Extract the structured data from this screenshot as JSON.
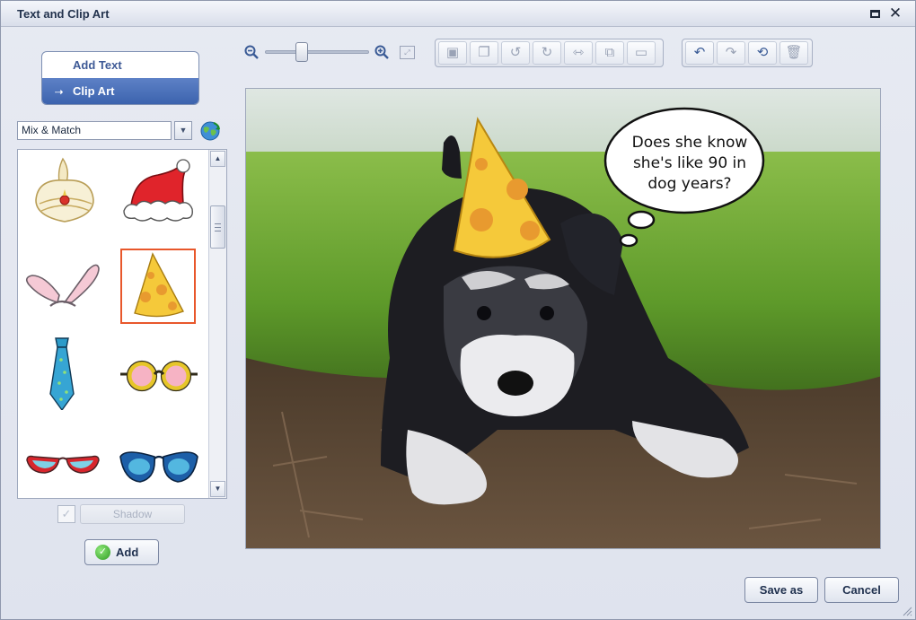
{
  "window": {
    "title": "Text and Clip Art"
  },
  "modes": [
    {
      "label": "Add Text",
      "active": false
    },
    {
      "label": "Clip Art",
      "active": true,
      "icon": "arrow-icon"
    }
  ],
  "clipart": {
    "category": "Mix & Match",
    "items": [
      "turban",
      "santa-hat",
      "bunny-ears",
      "party-hat",
      "necktie",
      "round-glasses",
      "sunglasses",
      "masquerade-glasses"
    ],
    "selected": "party-hat"
  },
  "options": {
    "shadow_label": "Shadow",
    "add_label": "Add"
  },
  "zoom": {
    "level": 0.33
  },
  "toolbar": {
    "edit_tools": [
      "crop-icon",
      "copy-icon",
      "rotate-left-icon",
      "rotate-right-icon",
      "flip-icon",
      "send-back-icon",
      "bring-front-icon"
    ],
    "history_tools": [
      "undo-icon",
      "redo-icon",
      "undo-all-icon",
      "delete-icon"
    ]
  },
  "canvas": {
    "bubble_text": [
      "Does she know",
      "she's like 90 in",
      "dog years?"
    ]
  },
  "footer": {
    "save_label": "Save as",
    "cancel_label": "Cancel"
  },
  "colors": {
    "accent": "#4a6fb8",
    "selection": "#e8572b",
    "hat": "#f5c93a"
  }
}
